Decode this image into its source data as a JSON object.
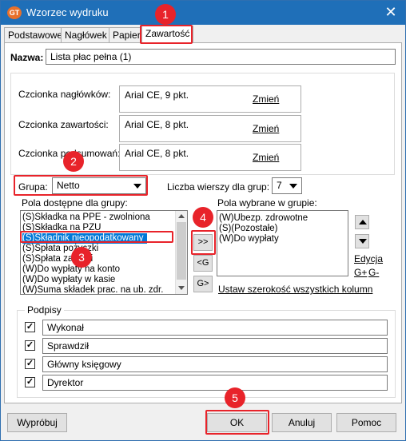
{
  "window": {
    "title": "Wzorzec wydruku",
    "close_glyph": "✕",
    "icon_text": "GT"
  },
  "tabs": [
    {
      "label": "Podstawowe"
    },
    {
      "label": "Nagłówek"
    },
    {
      "label": "Papier"
    },
    {
      "label": "Zawartość"
    }
  ],
  "name_field": {
    "label": "Nazwa:",
    "value": "Lista płac pełna (1)"
  },
  "fonts": {
    "header": {
      "label": "Czcionka nagłówków:",
      "value": "Arial CE, 9 pkt.",
      "change": "Zmień"
    },
    "content": {
      "label": "Czcionka zawartości:",
      "value": "Arial CE, 8 pkt.",
      "change": "Zmień"
    },
    "summary": {
      "label": "Czcionka podsumowań:",
      "value": "Arial CE, 8 pkt.",
      "change": "Zmień"
    }
  },
  "group": {
    "label": "Grupa:",
    "value": "Netto"
  },
  "rows_per_group": {
    "label": "Liczba wierszy dla grup:",
    "value": "7"
  },
  "available_fields": {
    "label": "Pola dostępne dla grupy:",
    "items": [
      "(S)Składka na PPE - zwolniona",
      "(S)Składka na PZU",
      "(S)Składnik nieopodatkowany",
      "(S)Spłata pożyczki",
      "(S)Spłata zaliczki",
      "(W)Do wypłaty na konto",
      "(W)Do wypłaty w kasie",
      "(W)Suma składek prac. na ub. zdr."
    ],
    "selected_index": 2
  },
  "move_buttons": {
    "add": ">>",
    "remove": "<G",
    "add_group": "G>"
  },
  "selected_fields": {
    "label": "Pola wybrane w grupie:",
    "items": [
      "(W)Ubezp. zdrowotne",
      "(S)(Pozostałe)",
      "(W)Do wypłaty"
    ]
  },
  "edit_links": {
    "edit": "Edycja",
    "g_plus": "G+",
    "g_minus": "G-"
  },
  "set_width_link": "Ustaw szerokość wszystkich kolumn",
  "signatures": {
    "label": "Podpisy",
    "items": [
      {
        "checked": true,
        "value": "Wykonał"
      },
      {
        "checked": true,
        "value": "Sprawdził"
      },
      {
        "checked": true,
        "value": "Główny księgowy"
      },
      {
        "checked": true,
        "value": "Dyrektor"
      }
    ],
    "check_glyph": "✓"
  },
  "buttons": {
    "try": "Wypróbuj",
    "ok": "OK",
    "cancel": "Anuluj",
    "help": "Pomoc"
  },
  "annotations": [
    "1",
    "2",
    "3",
    "4",
    "5"
  ],
  "colors": {
    "titlebar": "#1f6fb8",
    "highlight": "#e8232a",
    "selection": "#0078d7"
  }
}
